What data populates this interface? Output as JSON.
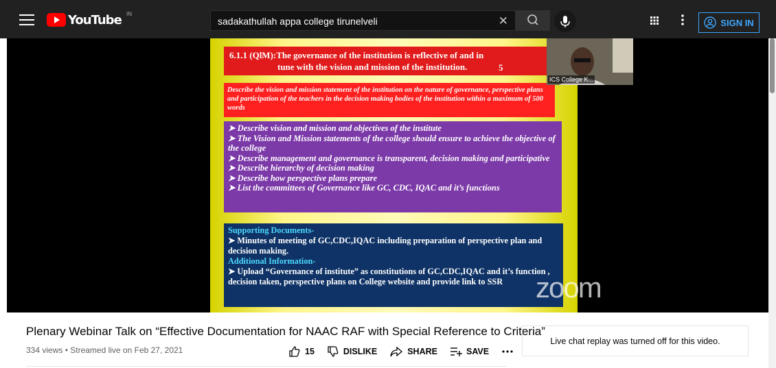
{
  "header": {
    "logo_text": "YouTube",
    "country_code": "IN",
    "search_value": "sadakathullah appa college tirunelveli",
    "signin_label": "SIGN IN"
  },
  "slide": {
    "title_line1": "6.1.1 (QlM):The governance of the institution is reflective of and in",
    "title_line2": "tune with the vision and mission of the institution.",
    "title_number": "5",
    "description": "Describe the vision and mission statement of the institution on the nature of governance, perspective plans and participation of the teachers in the decision making bodies of the institution within a maximum of 500 words",
    "list_items": [
      "Describe vision and mission and objectives of the institute",
      " The Vision and Mission statements of the college should ensure to achieve the objective of the college",
      "Describe management and governance is transparent, decision making and participative",
      "Describe hierarchy of decision making",
      "Describe how perspective plans prepare",
      "List the committees of Governance like GC, CDC, IQAC and it’s functions"
    ],
    "supporting_heading": "Supporting Documents-",
    "supporting_item": " Minutes of meeting of GC,CDC,IQAC including preparation of perspective plan and decision making.",
    "additional_heading": "Additional Information-",
    "additional_item": "Upload “Governance of institute” as constitutions of GC,CDC,IQAC and it’s function , decision taken, perspective plans on College website and provide link to SSR"
  },
  "webcam": {
    "name": "ICS College K..."
  },
  "watermark": "zoom",
  "video": {
    "title": "Plenary Webinar Talk on “Effective Documentation for NAAC RAF with Special Reference to Criteria”",
    "meta": "334 views • Streamed live on Feb 27, 2021"
  },
  "actions": {
    "like_count": "15",
    "dislike_label": "DISLIKE",
    "share_label": "SHARE",
    "save_label": "SAVE"
  },
  "chat": {
    "notice": "Live chat replay was turned off for this video."
  },
  "colors": {
    "brand_red": "#ff0000",
    "signin_blue": "#3ea6ff"
  },
  "icons": [
    "menu-icon",
    "search-icon",
    "mic-icon",
    "apps-icon",
    "more-vert-icon",
    "account-icon",
    "like-icon",
    "dislike-icon",
    "share-icon",
    "save-icon",
    "more-horiz-icon",
    "close-icon"
  ]
}
